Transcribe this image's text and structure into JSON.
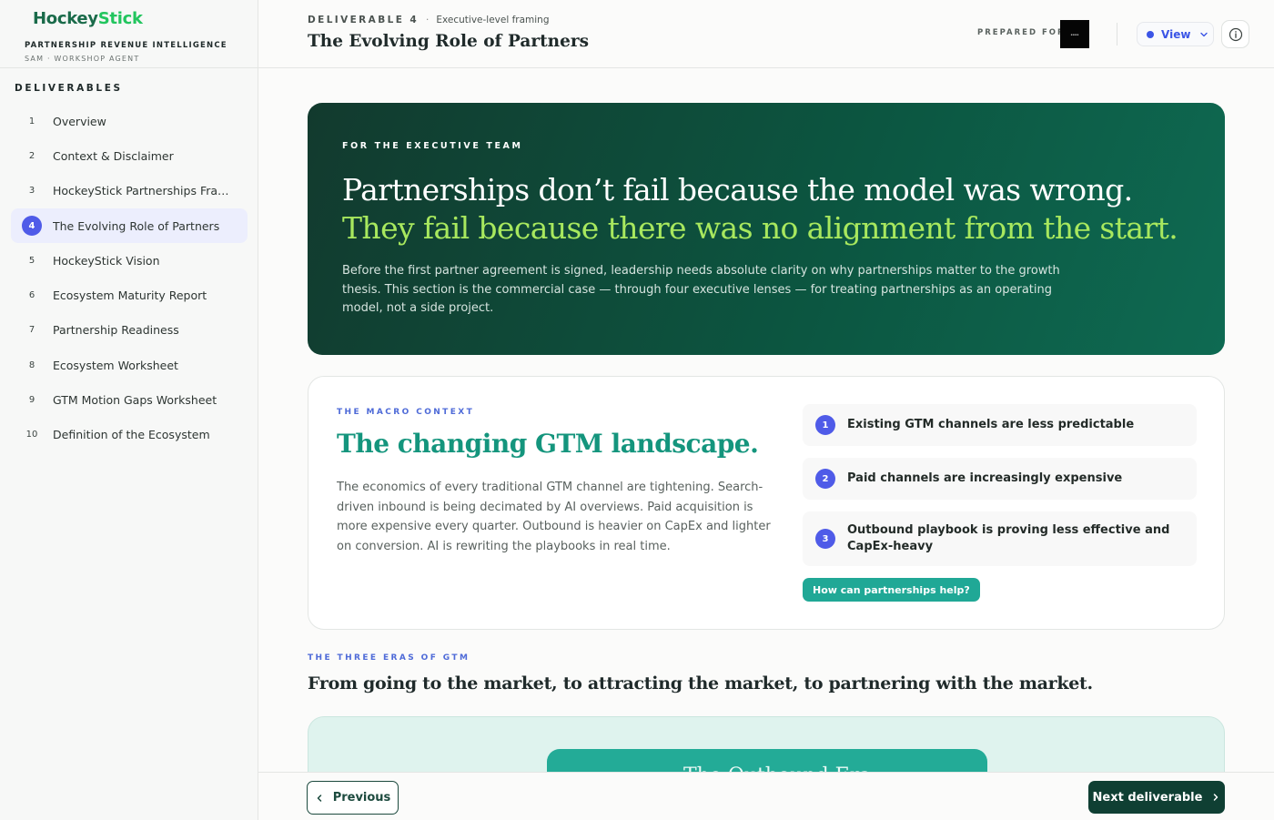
{
  "brand": {
    "logo_part1": "Hockey",
    "logo_part2": "Stick",
    "subtitle": "PARTNERSHIP REVENUE INTELLIGENCE",
    "agent": "SAM · WORKSHOP AGENT"
  },
  "sidebar": {
    "title": "DELIVERABLES",
    "active_index": 3,
    "items": [
      {
        "num": "1",
        "label": "Overview"
      },
      {
        "num": "2",
        "label": "Context & Disclaimer"
      },
      {
        "num": "3",
        "label": "HockeyStick Partnerships Framework"
      },
      {
        "num": "4",
        "label": "The Evolving Role of Partners"
      },
      {
        "num": "5",
        "label": "HockeyStick Vision"
      },
      {
        "num": "6",
        "label": "Ecosystem Maturity Report"
      },
      {
        "num": "7",
        "label": "Partnership Readiness"
      },
      {
        "num": "8",
        "label": "Ecosystem Worksheet"
      },
      {
        "num": "9",
        "label": "GTM Motion Gaps Worksheet"
      },
      {
        "num": "10",
        "label": "Definition of the Ecosystem"
      }
    ]
  },
  "header": {
    "deliverable": "DELIVERABLE 4",
    "separator": "·",
    "framing": "Executive-level framing",
    "title": "The Evolving Role of Partners",
    "prepared_for": "PREPARED FOR",
    "view_label": "View",
    "accent_color": "#3b55e6"
  },
  "hero": {
    "kicker": "FOR THE EXECUTIVE TEAM",
    "line1": "Partnerships don’t fail because the model was wrong.",
    "line2": "They fail because there was no alignment from the start.",
    "body": "Before the first partner agreement is signed, leadership needs absolute clarity on why partnerships matter to the growth thesis. This section is the commercial case — through four executive lenses — for treating partnerships as an operating model, not a side project."
  },
  "macro": {
    "kicker": "THE MACRO CONTEXT",
    "title": "The changing GTM landscape.",
    "body": "The economics of every traditional GTM channel are tightening. Search-driven inbound is being decimated by AI overviews. Paid acquisition is more expensive every quarter. Outbound is heavier on CapEx and lighter on conversion. AI is rewriting the playbooks in real time.",
    "points": [
      {
        "num": "1",
        "label": "Existing GTM channels are less predictable"
      },
      {
        "num": "2",
        "label": "Paid channels are increasingly expensive"
      },
      {
        "num": "3",
        "label": "Outbound playbook is proving less effective and CapEx-heavy"
      }
    ],
    "cta": "How can partnerships help?"
  },
  "eras": {
    "kicker": "THE THREE ERAS OF GTM",
    "title": "From going to the market, to attracting the market, to partnering with the market.",
    "first_era": "The Outbound Era"
  },
  "footer": {
    "previous": "Previous",
    "next": "Next deliverable"
  }
}
